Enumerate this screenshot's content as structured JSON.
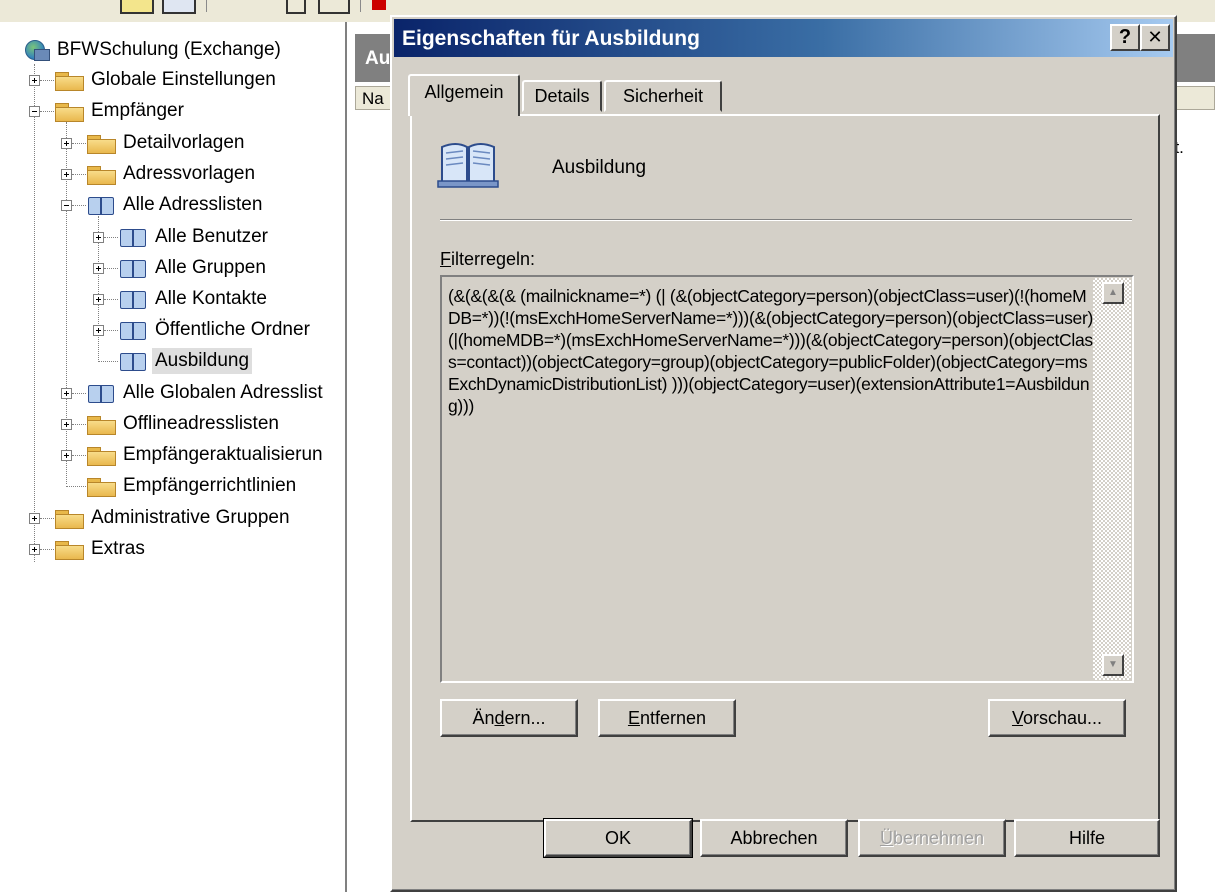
{
  "tree": {
    "root": "BFWSchulung (Exchange)",
    "items": [
      {
        "label": "Globale Einstellungen"
      },
      {
        "label": "Empfänger"
      },
      {
        "label": "Detailvorlagen"
      },
      {
        "label": "Adressvorlagen"
      },
      {
        "label": "Alle Adresslisten"
      },
      {
        "label": "Alle Benutzer"
      },
      {
        "label": "Alle Gruppen"
      },
      {
        "label": "Alle Kontakte"
      },
      {
        "label": "Öffentliche Ordner"
      },
      {
        "label": "Ausbildung"
      },
      {
        "label": "Alle Globalen Adresslist"
      },
      {
        "label": "Offlineadresslisten"
      },
      {
        "label": "Empfängeraktualisierun"
      },
      {
        "label": "Empfängerrichtlinien"
      },
      {
        "label": "Administrative Gruppen"
      },
      {
        "label": "Extras"
      }
    ]
  },
  "result_pane": {
    "header": "Au",
    "column": "Na",
    "message_fragment": "gt."
  },
  "dialog": {
    "title": "Eigenschaften für Ausbildung",
    "help_button": "?",
    "close_button": "✕",
    "tabs": [
      {
        "label": "Allgemein",
        "active": true
      },
      {
        "label": "Details",
        "active": false
      },
      {
        "label": "Sicherheit",
        "active": false
      }
    ],
    "object_name": "Ausbildung",
    "filter_label_first": "F",
    "filter_label_rest": "ilterregeln:",
    "filter_text": "(&(&(&(& (mailnickname=*) (| (&(objectCategory=person)(objectClass=user)(!(homeMDB=*))(!(msExchHomeServerName=*)))(&(objectCategory=person)(objectClass=user)(|(homeMDB=*)(msExchHomeServerName=*)))(&(objectCategory=person)(objectClass=contact))(objectCategory=group)(objectCategory=publicFolder)(objectCategory=msExchDynamicDistributionList) )))(objectCategory=user)(extensionAttribute1=Ausbildung)))",
    "buttons": {
      "change_pre": "Än",
      "change_u": "d",
      "change_post": "ern...",
      "remove_u": "E",
      "remove_post": "ntfernen",
      "preview_u": "V",
      "preview_post": "orschau...",
      "ok": "OK",
      "cancel": "Abbrechen",
      "apply_u": "Ü",
      "apply_post": "bernehmen",
      "help": "Hilfe"
    }
  }
}
